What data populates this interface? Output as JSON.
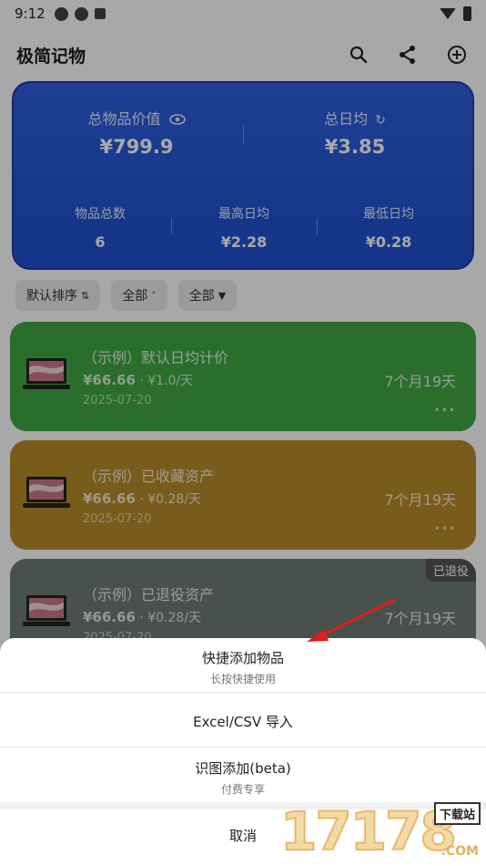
{
  "status": {
    "time": "9:12"
  },
  "app": {
    "title": "极简记物"
  },
  "summary": {
    "total_value_label": "总物品价值",
    "total_value": "¥799.9",
    "daily_label": "总日均",
    "daily_value": "¥3.85",
    "count_label": "物品总数",
    "count_value": "6",
    "max_label": "最高日均",
    "max_value": "¥2.28",
    "min_label": "最低日均",
    "min_value": "¥0.28"
  },
  "filters": [
    {
      "label": "默认排序",
      "icon": "⇅"
    },
    {
      "label": "全部",
      "icon": "˅"
    },
    {
      "label": "全部",
      "icon": "▼"
    }
  ],
  "cards": [
    {
      "name": "（示例）默认日均计价",
      "price": "¥66.66",
      "per_day": " · ¥1.0/天",
      "date": "2025-07-20",
      "duration": "7个月19天",
      "dots": "•••",
      "color": "#42a843"
    },
    {
      "name": "（示例）已收藏资产",
      "price": "¥66.66",
      "per_day": " · ¥0.28/天",
      "date": "2025-07-20",
      "duration": "7个月19天",
      "dots": "•••",
      "color": "#b88a2a"
    },
    {
      "name": "（示例）已退役资产",
      "price": "¥66.66",
      "per_day": " · ¥0.28/天",
      "date": "2025-07-20",
      "duration": "7个月19天",
      "badge": "已退役",
      "color": "#6f7b74"
    }
  ],
  "sheet": {
    "quick_add": "快捷添加物品",
    "quick_add_sub": "长按快捷使用",
    "import": "Excel/CSV 导入",
    "image_add": "识图添加(beta)",
    "image_add_sub": "付费专享",
    "cancel": "取消"
  },
  "watermark": {
    "digits": "17178",
    "tag": "下载站",
    "domain": ".COM"
  },
  "colors": {
    "summary_bg": "#1e4fd0",
    "arrow": "#d8201c"
  }
}
